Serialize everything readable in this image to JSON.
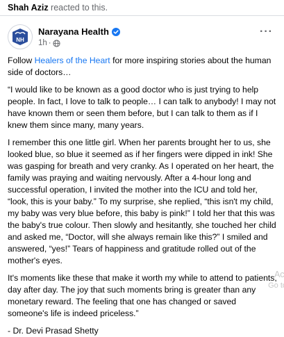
{
  "reacted": {
    "name": "Shah Aziz",
    "text": " reacted to this."
  },
  "post": {
    "author": "Narayana Health",
    "time": "1h",
    "separator": "·",
    "more": "···",
    "intro_before": "Follow ",
    "intro_link": "Healers of the Heart",
    "intro_after": " for more inspiring stories about the human side of doctors…",
    "paragraph1": "“I would like to be known as a good doctor who is just trying to help people. In fact, I love to talk to people… I can talk to anybody! I may not have known them or seen them before, but I can talk to them as if I knew them since many, many years.",
    "paragraph2": "I remember this one little girl. When her parents brought her to us, she looked blue, so blue it seemed as if her fingers were dipped in ink! She was gasping for breath and very cranky. As I operated on her heart, the family was praying and waiting nervously. After a 4-hour long and successful operation, I invited the mother into the ICU and told her, “look, this is your baby.” To my surprise, she replied, “this isn't my child, my baby was very blue before, this baby is pink!” I told her that this was the baby's true colour. Then slowly and hesitantly, she touched her child and asked me, “Doctor, will she always remain like this?” I smiled and answered, “yes!” Tears of happiness and gratitude rolled out of the mother's eyes.",
    "paragraph3": "It's moments like these that make it worth my while to attend to patients, day after day. The joy that such moments bring is greater than any monetary reward. The feeling that one has changed or saved someone's life is indeed priceless.”",
    "signature": "- Dr. Devi Prasad Shetty"
  },
  "watermark": {
    "line1": "Act",
    "line2": "Go to"
  },
  "colors": {
    "link": "#1877f2",
    "secondary_text": "#65676b",
    "verified": "#1877f2",
    "logo": "#2b4e9c"
  },
  "icons": {
    "verified": "verified-badge-icon",
    "audience": "globe-icon",
    "more": "more-horizontal-icon"
  }
}
